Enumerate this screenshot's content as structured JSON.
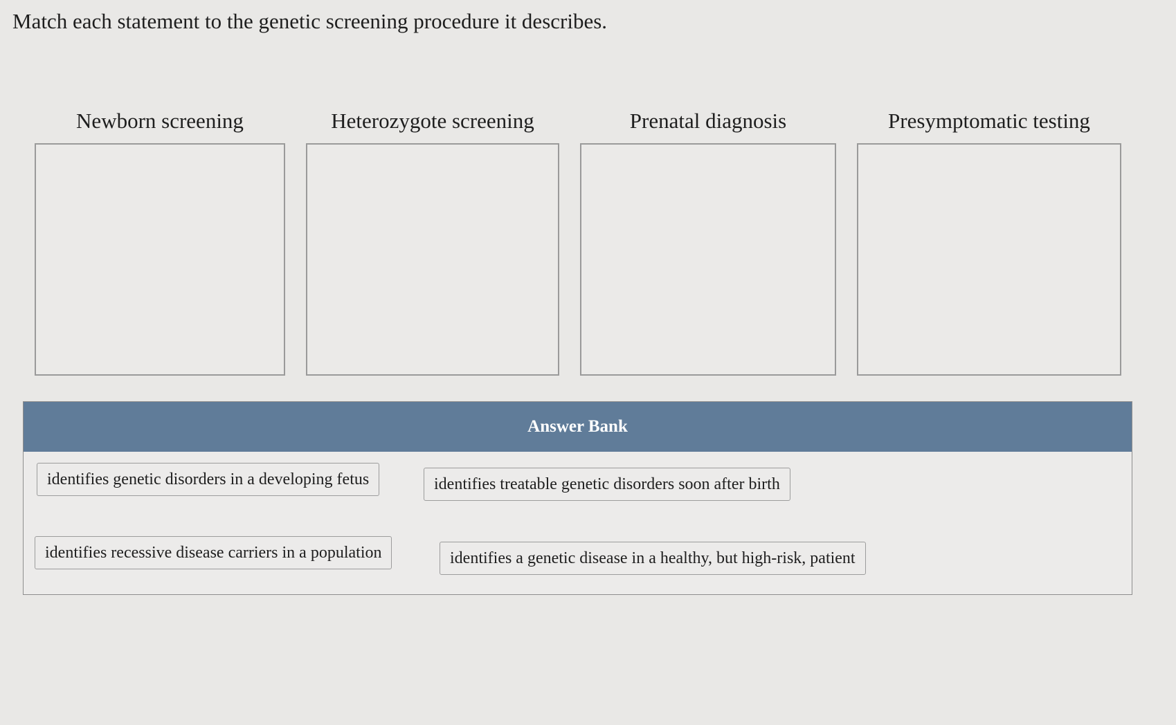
{
  "question": {
    "prompt": "Match each statement to the genetic screening procedure it describes."
  },
  "targets": [
    {
      "label": "Newborn screening"
    },
    {
      "label": "Heterozygote screening"
    },
    {
      "label": "Prenatal diagnosis"
    },
    {
      "label": "Presymptomatic testing"
    }
  ],
  "answer_bank": {
    "title": "Answer Bank",
    "items": [
      {
        "label": "identifies genetic disorders in a developing fetus"
      },
      {
        "label": "identifies treatable genetic disorders soon after birth"
      },
      {
        "label": "identifies recessive disease carriers in a population"
      },
      {
        "label": "identifies a genetic disease in a healthy, but high-risk, patient"
      }
    ]
  }
}
